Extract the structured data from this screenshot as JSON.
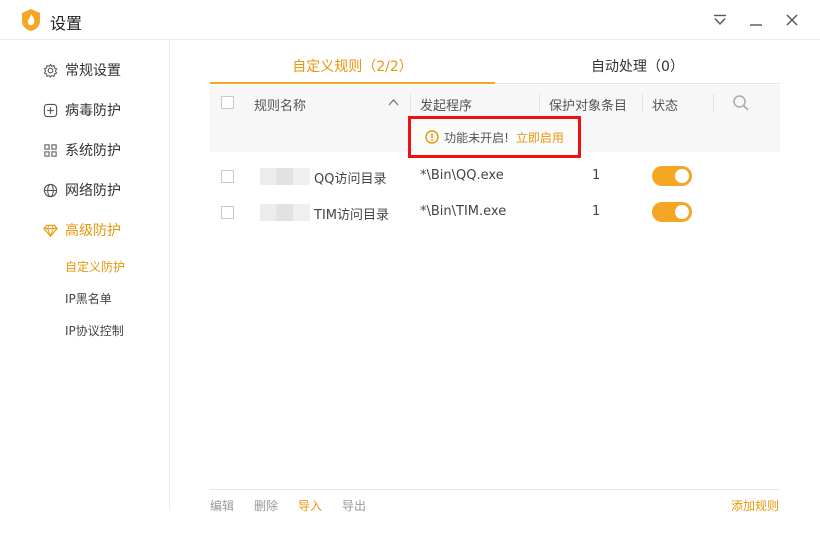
{
  "window": {
    "title": "设置"
  },
  "sidebar": {
    "items": [
      {
        "label": "常规设置"
      },
      {
        "label": "病毒防护"
      },
      {
        "label": "系统防护"
      },
      {
        "label": "网络防护"
      },
      {
        "label": "高级防护"
      }
    ],
    "sub_items": [
      {
        "label": "自定义防护"
      },
      {
        "label": "IP黑名单"
      },
      {
        "label": "IP协议控制"
      }
    ]
  },
  "tabs": [
    {
      "label": "自定义规则（2/2）"
    },
    {
      "label": "自动处理（0）"
    }
  ],
  "table": {
    "columns": [
      "规则名称",
      "发起程序",
      "保护对象条目",
      "状态"
    ],
    "notice": {
      "text": "功能未开启!",
      "action": "立即启用"
    },
    "rows": [
      {
        "name": "QQ访问目录",
        "program": "*\\Bin\\QQ.exe",
        "count": "1"
      },
      {
        "name": "TIM访问目录",
        "program": "*\\Bin\\TIM.exe",
        "count": "1"
      }
    ]
  },
  "footer": {
    "edit": "编辑",
    "delete": "删除",
    "import": "导入",
    "export": "导出",
    "add": "添加规则"
  },
  "colors": {
    "accent": "#f5a623",
    "accent_text": "#e8960c",
    "alert_border": "#ee1111"
  }
}
